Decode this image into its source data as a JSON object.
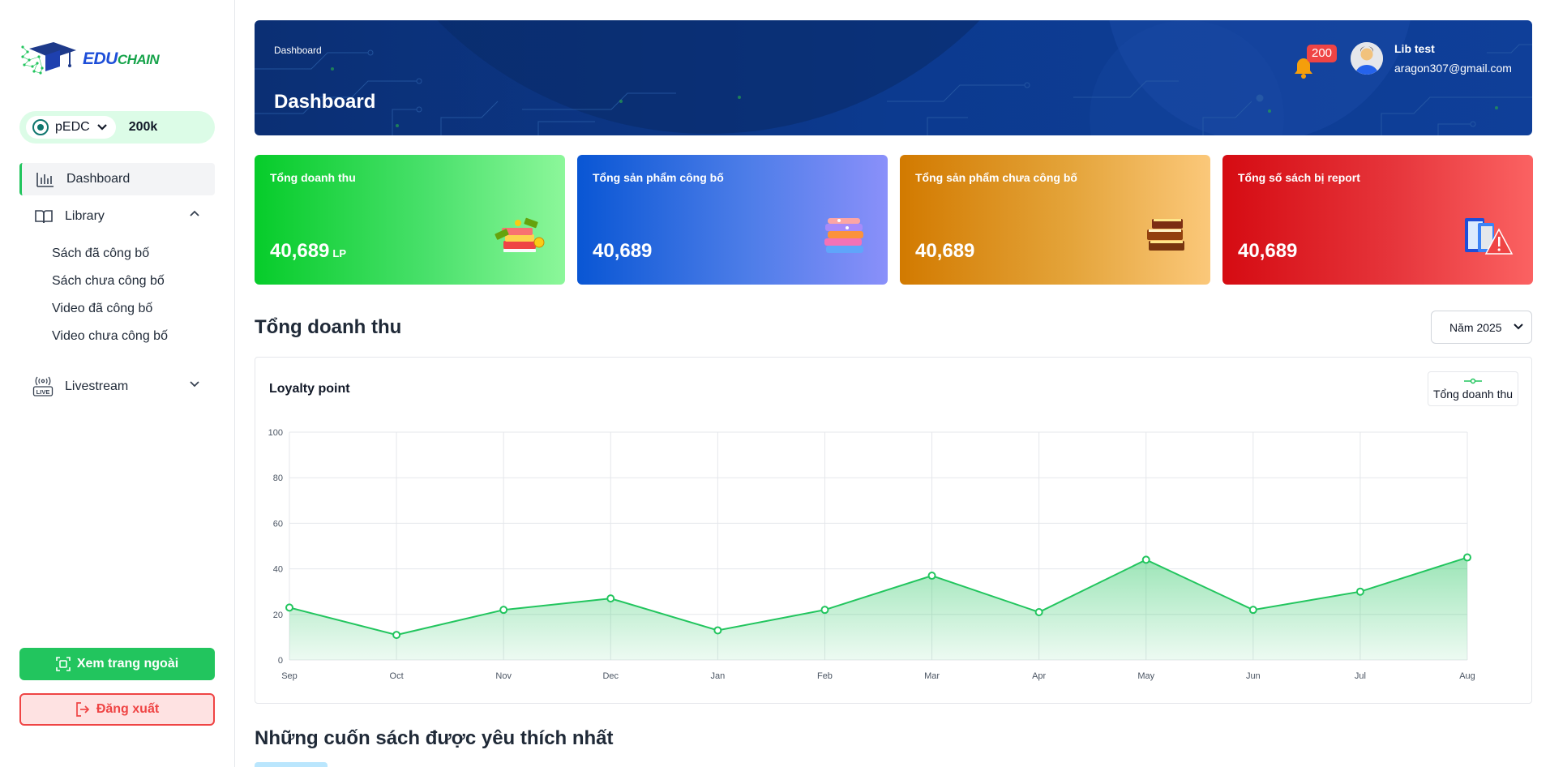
{
  "brand": {
    "name_edu": "EDU",
    "name_chain": "CHAIN"
  },
  "wallet": {
    "token": "pEDC",
    "balance": "200k"
  },
  "sidebar": {
    "dashboard": "Dashboard",
    "library": "Library",
    "library_items": [
      "Sách đã công bố",
      "Sách chưa công bố",
      "Video đã công bố",
      "Video chưa công bố"
    ],
    "livestream": "Livestream",
    "external_button": "Xem trang ngoài",
    "logout_button": "Đăng xuất"
  },
  "header": {
    "breadcrumb": "Dashboard",
    "title": "Dashboard",
    "notification_count": "200",
    "user_name": "Lib test",
    "user_email": "aragon307@gmail.com"
  },
  "stats": [
    {
      "title": "Tổng doanh thu",
      "value": "40,689",
      "unit": "LP",
      "color": "#06cc2a",
      "icon": "money-books-icon"
    },
    {
      "title": "Tổng sản phẩm công bố",
      "value": "40,689",
      "unit": "",
      "color": "#0956d4",
      "icon": "book-stack-icon"
    },
    {
      "title": "Tổng sản phẩm chưa công bố",
      "value": "40,689",
      "unit": "",
      "color": "#d27a00",
      "icon": "closed-books-icon"
    },
    {
      "title": "Tổng số sách bị report",
      "value": "40,689",
      "unit": "",
      "color": "#d50b12",
      "icon": "book-warning-icon"
    }
  ],
  "revenue": {
    "section_title": "Tổng doanh thu",
    "year_selected": "Năm 2025",
    "chart_title": "Loyalty point",
    "legend": "Tổng doanh thu"
  },
  "chart_data": {
    "type": "area",
    "title": "Loyalty point",
    "categories": [
      "Sep",
      "Oct",
      "Nov",
      "Dec",
      "Jan",
      "Feb",
      "Mar",
      "Apr",
      "May",
      "Jun",
      "Jul",
      "Aug"
    ],
    "series": [
      {
        "name": "Tổng doanh thu",
        "values": [
          23,
          11,
          22,
          27,
          13,
          22,
          37,
          21,
          44,
          22,
          30,
          45
        ],
        "color": "#22c55e"
      }
    ],
    "yticks": [
      "0",
      "20",
      "40",
      "60",
      "80",
      "100"
    ],
    "ylim": [
      0,
      100
    ],
    "grid": true,
    "legend_position": "top-right"
  },
  "favorites": {
    "section_title": "Những cuốn sách được yêu thích nhất"
  },
  "colors": {
    "accent": "#22c55e",
    "danger": "#ef4444",
    "banner": "#0c3a8f"
  }
}
